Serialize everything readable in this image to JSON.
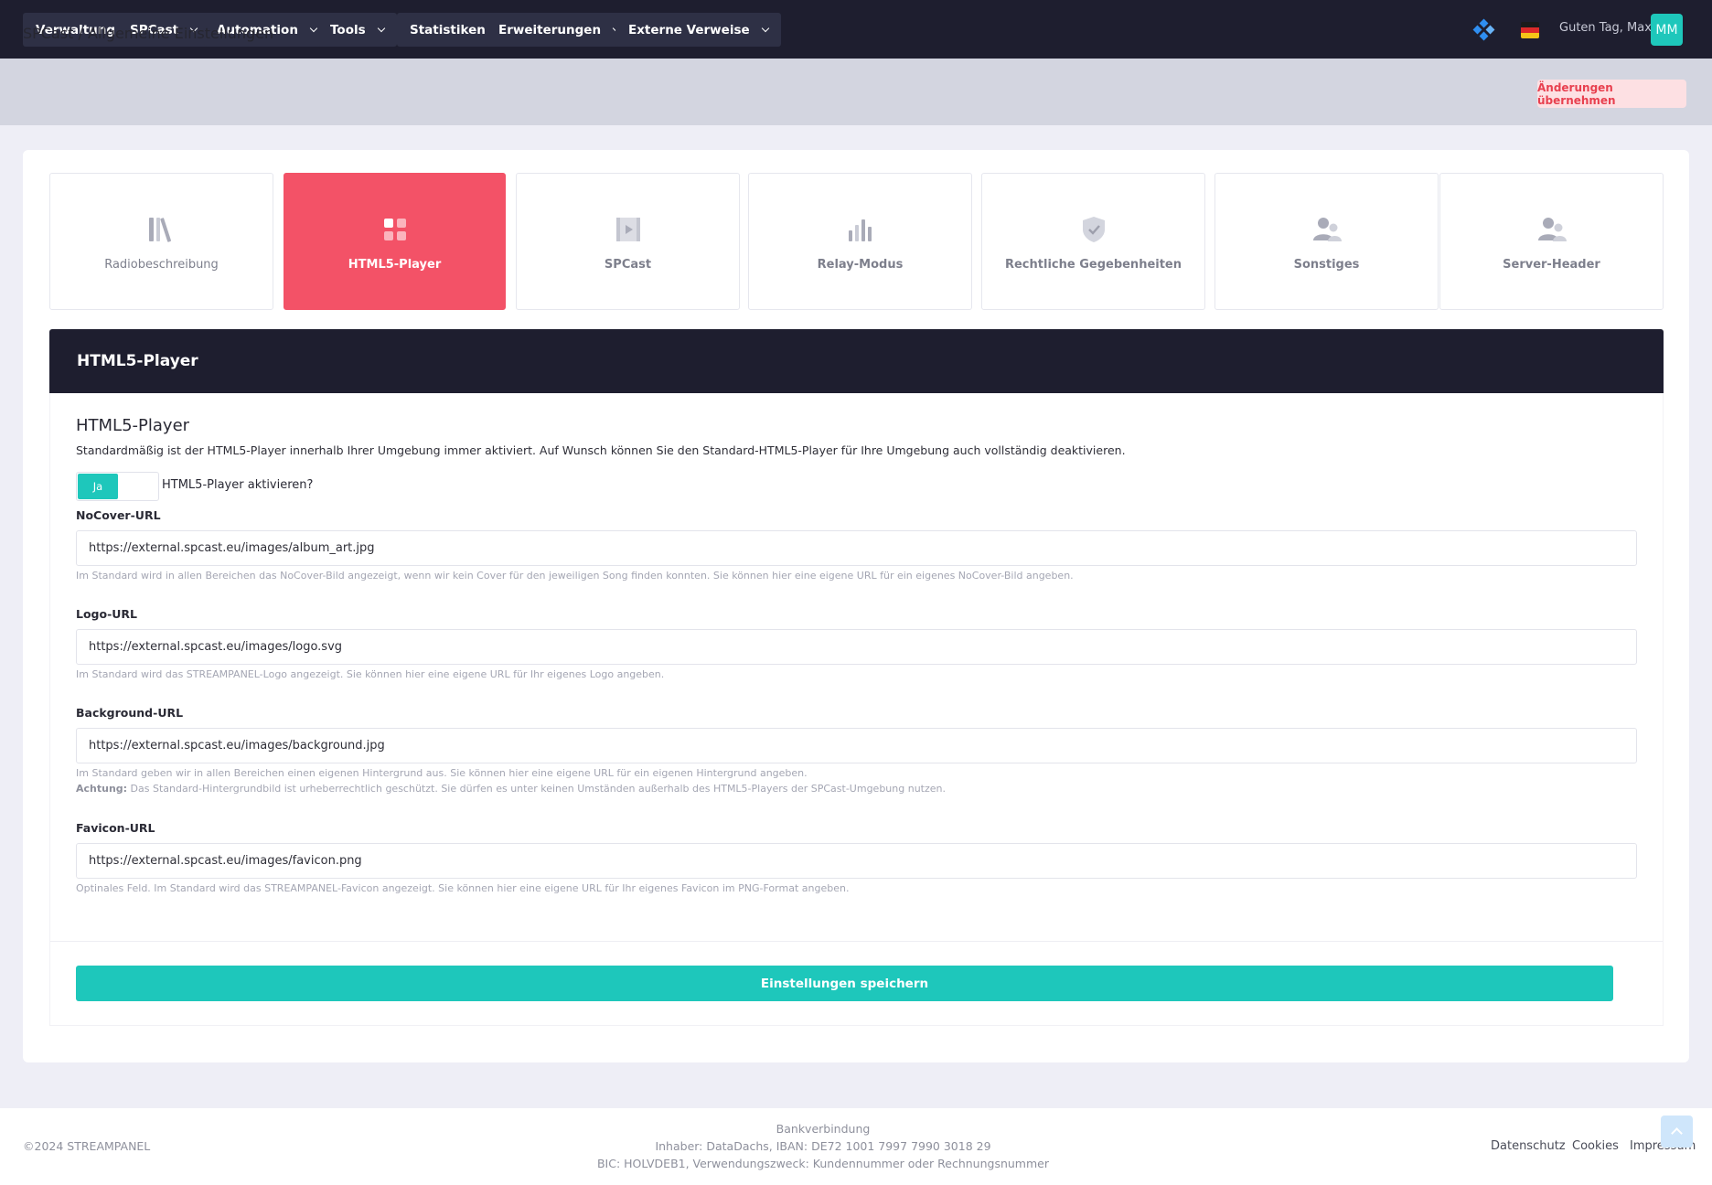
{
  "nav": {
    "items": [
      {
        "label": "Verwaltung"
      },
      {
        "label": "SPCast"
      },
      {
        "label": "Automation"
      },
      {
        "label": "Tools"
      },
      {
        "label": "Statistiken"
      },
      {
        "label": "Erweiterungen"
      },
      {
        "label": "Externe Verweise"
      }
    ],
    "greeting": "Guten Tag, Max",
    "avatar_initials": "MM"
  },
  "header": {
    "breadcrumb": "SPCast / Allgemeine Einstellungen",
    "apply_button": "Änderungen übernehmen"
  },
  "tabs": [
    {
      "label": "Radiobeschreibung",
      "icon": "library-icon"
    },
    {
      "label": "HTML5-Player",
      "icon": "grid-icon",
      "active": true
    },
    {
      "label": "SPCast",
      "icon": "video-icon"
    },
    {
      "label": "Relay-Modus",
      "icon": "bar-chart-icon"
    },
    {
      "label": "Rechtliche Gegebenheiten",
      "icon": "shield-check-icon"
    },
    {
      "label": "Sonstiges",
      "icon": "users-icon"
    },
    {
      "label": "Server-Header",
      "icon": "users-icon"
    }
  ],
  "section": {
    "header": "HTML5-Player",
    "title": "HTML5-Player",
    "description": "Standardmäßig ist der HTML5-Player innerhalb Ihrer Umgebung immer aktiviert. Auf Wunsch können Sie den Standard-HTML5-Player für Ihre Umgebung auch vollständig deaktivieren.",
    "toggle": {
      "value": "Ja",
      "label": "HTML5-Player aktivieren?"
    }
  },
  "fields": {
    "nocover": {
      "label": "NoCover-URL",
      "value": "https://external.spcast.eu/images/album_art.jpg",
      "help": "Im Standard wird in allen Bereichen das NoCover-Bild angezeigt, wenn wir kein Cover für den jeweiligen Song finden konnten. Sie können hier eine eigene URL für ein eigenes NoCover-Bild angeben."
    },
    "logo": {
      "label": "Logo-URL",
      "value": "https://external.spcast.eu/images/logo.svg",
      "help": "Im Standard wird das STREAMPANEL-Logo angezeigt. Sie können hier eine eigene URL für Ihr eigenes Logo angeben."
    },
    "background": {
      "label": "Background-URL",
      "value": "https://external.spcast.eu/images/background.jpg",
      "help": "Im Standard geben wir in allen Bereichen einen eigenen Hintergrund aus. Sie können hier eine eigene URL für ein eigenen Hintergrund angeben.",
      "warning_label": "Achtung:",
      "warning": " Das Standard-Hintergrundbild ist urheberrechtlich geschützt. Sie dürfen es unter keinen Umständen außerhalb des HTML5-Players der SPCast-Umgebung nutzen."
    },
    "favicon": {
      "label": "Favicon-URL",
      "value": "https://external.spcast.eu/images/favicon.png",
      "help": "Optinales Feld. Im Standard wird das STREAMPANEL-Favicon angezeigt. Sie können hier eine eigene URL für Ihr eigenes Favicon im PNG-Format angeben."
    }
  },
  "save_button": "Einstellungen speichern",
  "footer": {
    "copyright": "©2024 STREAMPANEL",
    "bank_title": "Bankverbindung",
    "bank_line1": "Inhaber: DataDachs, IBAN: DE72 1001 7997 7990 3018 29",
    "bank_line2": "BIC: HOLVDEB1, Verwendungszweck: Kundennummer oder Rechnungsnummer",
    "links": [
      "Datenschutz",
      "Cookies",
      "Impressum"
    ]
  },
  "colors": {
    "accent": "#1ec7bb",
    "active_tab": "#f35267",
    "navbar": "#1e1e2f"
  }
}
